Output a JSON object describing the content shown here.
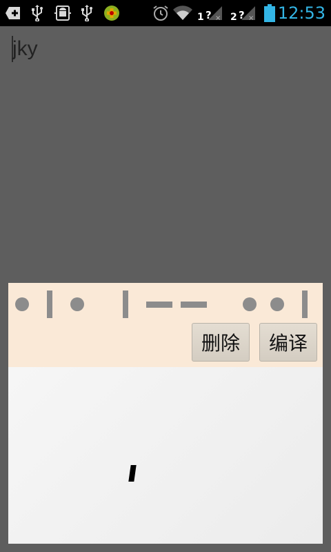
{
  "status_bar": {
    "icons": [
      "add-icon",
      "usb-icon",
      "android-debug-icon",
      "usb-icon",
      "app-plus-icon",
      "alarm-icon",
      "wifi-icon",
      "signal-sim1-icon",
      "signal-sim2-icon",
      "battery-icon"
    ],
    "sim1": "1",
    "sim2": "2",
    "time": "12:53"
  },
  "input": {
    "value": "jky"
  },
  "morse": {
    "symbols": [
      "dot",
      "bar",
      "dot",
      "bar",
      "dash",
      "dash",
      "dot",
      "dot",
      "bar"
    ]
  },
  "buttons": {
    "delete_label": "删除",
    "translate_label": "编译"
  },
  "colors": {
    "background": "#5e5e5e",
    "panel_top": "#fae9d7",
    "morse_mark": "#8c8c8c",
    "time_accent": "#33b5e5"
  }
}
